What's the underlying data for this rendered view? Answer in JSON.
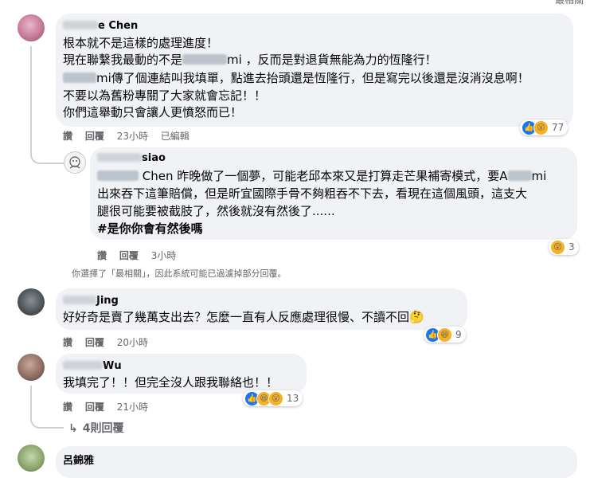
{
  "top": {
    "partial_label": "最相關"
  },
  "comments": [
    {
      "author_suffix": "e Chen",
      "lines": [
        "根本就不是這樣的處理進度！",
        "現在聯繫我最動的不是",
        "mi ，反而是對退貨無能為力的恆隆行！",
        "mi傳了個連結叫我填單，點進去抬頭還是恆隆行，但是寫完以後還是沒消沒息啊！",
        "不要以為舊粉專關了大家就會忘記！！",
        "你們這舉動只會讓人更憤怒而已！"
      ],
      "actions": {
        "like": "讚",
        "reply": "回覆",
        "time": "23小時",
        "edited": "已編輯"
      },
      "reactions": {
        "count": "77"
      }
    },
    {
      "author_suffix": "siao",
      "lines": [
        "Chen 昨晚做了一個夢，可能老邱本來又是打算走芒果補寄模式，要A",
        "mi",
        "出來吞下這筆賠償，但是昕宜國際手骨不夠粗吞不下去，看現在這個風頭，這支大",
        "腿很可能要被截肢了，然後就沒有然後了......",
        "#是你你會有然後嗎"
      ],
      "actions": {
        "like": "讚",
        "reply": "回覆",
        "time": "3小時"
      },
      "reactions": {
        "count": "3"
      }
    },
    {
      "author_suffix": "Jing",
      "lines": [
        "好好奇是賣了幾萬支出去？怎麼一直有人反應處理很慢、不讀不回"
      ],
      "actions": {
        "like": "讚",
        "reply": "回覆",
        "time": "20小時"
      },
      "reactions": {
        "count": "9"
      }
    },
    {
      "author_suffix": "Wu",
      "lines": [
        "我填完了！！但完全沒人跟我聯絡也！！"
      ],
      "actions": {
        "like": "讚",
        "reply": "回覆",
        "time": "21小時"
      },
      "reactions": {
        "count": "13"
      }
    }
  ],
  "filter_note": "你選擇了「最相關」，因此系統可能已過濾掉部分回覆。",
  "more_replies": "4則回覆",
  "bottom_author": "呂錦雅"
}
